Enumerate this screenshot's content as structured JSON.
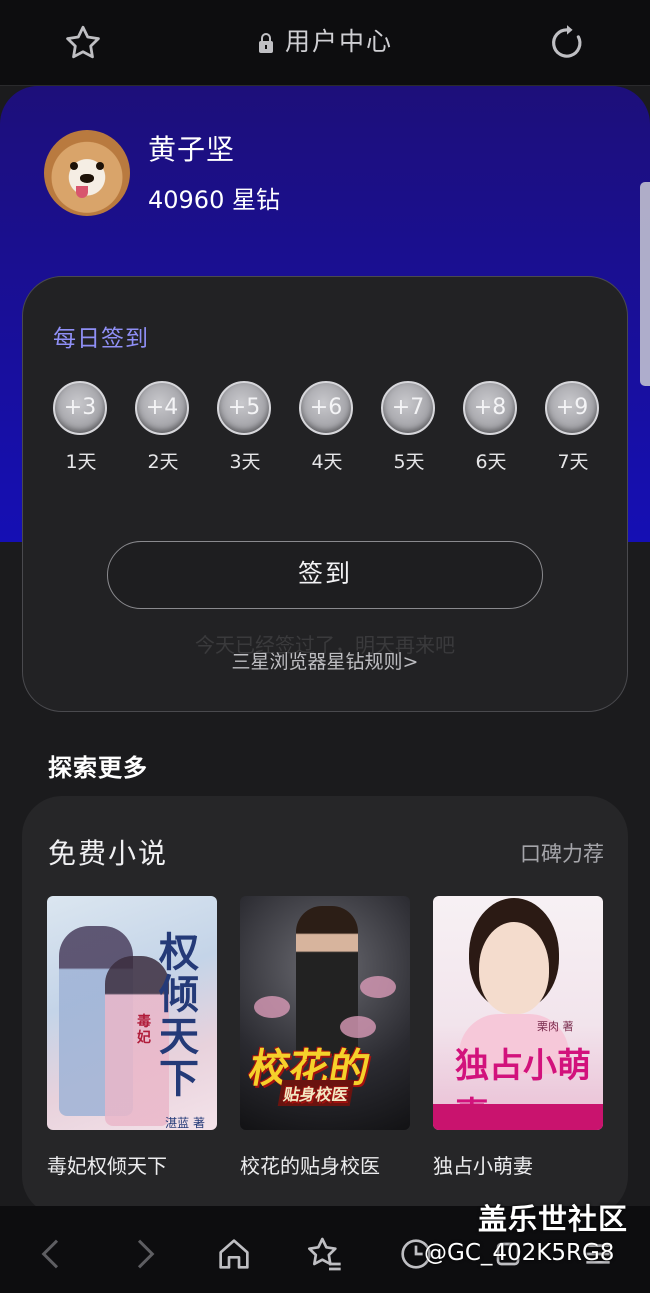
{
  "topbar": {
    "title": "用户中心",
    "bookmark_icon": "star-outline-icon",
    "lock_icon": "lock-icon",
    "refresh_icon": "refresh-icon"
  },
  "profile": {
    "name": "黄子坚",
    "points": "40960 星钻"
  },
  "checkin": {
    "header": "每日签到",
    "days": [
      {
        "reward": "+3",
        "label": "1天"
      },
      {
        "reward": "+4",
        "label": "2天"
      },
      {
        "reward": "+5",
        "label": "3天"
      },
      {
        "reward": "+6",
        "label": "4天"
      },
      {
        "reward": "+7",
        "label": "5天"
      },
      {
        "reward": "+8",
        "label": "6天"
      },
      {
        "reward": "+9",
        "label": "7天"
      }
    ],
    "button_label": "签到",
    "ghost_text": "今天已经签过了，明天再来吧",
    "rules_link": "三星浏览器星钻规则>"
  },
  "explore": {
    "title": "探索更多",
    "section_title": "免费小说",
    "section_more": "口碑力荐",
    "books": [
      {
        "title": "毒妃权倾天下",
        "cover_text": "权倾天下",
        "cover_sub": "毒妃",
        "author": "湛蓝 著"
      },
      {
        "title": "校花的贴身校医",
        "cover_text": "校花的",
        "cover_sub": "贴身校医"
      },
      {
        "title": "独占小萌妻",
        "cover_text": "独占小萌妻",
        "author": "栗肉 著"
      }
    ]
  },
  "bottombar": {
    "icons": [
      "back-icon",
      "forward-icon",
      "home-icon",
      "bookmarks-icon",
      "history-icon",
      "tabs-icon",
      "menu-icon"
    ]
  },
  "watermark": {
    "line1": "盖乐世社区",
    "line2": "@GC_402K5RG8"
  },
  "colors": {
    "hero_gradient_start": "#1d0f7a",
    "hero_gradient_end": "#150fb4",
    "accent": "#8f8ff5",
    "card_bg": "#222224",
    "page_bg": "#1b1b1d"
  }
}
